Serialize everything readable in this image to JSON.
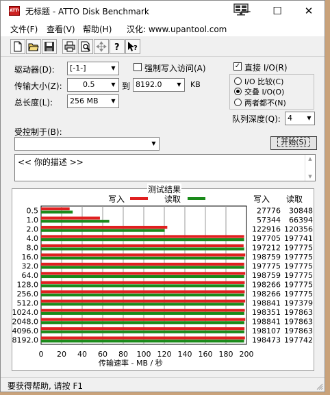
{
  "window": {
    "app_icon_text": "ATTO",
    "title": "无标题 - ATTO Disk Benchmark",
    "min_glyph": "—",
    "max_glyph": "☐",
    "close_glyph": "✕"
  },
  "menu": {
    "file": "文件(F)",
    "view": "查看(V)",
    "help": "帮助(H)",
    "localized": "汉化: www.upantool.com"
  },
  "icons": [
    "new-file-icon",
    "open-folder-icon",
    "save-icon",
    "print-icon",
    "print-preview-icon",
    "move-icon",
    "help-icon",
    "context-help-icon"
  ],
  "form": {
    "drive_label": "驱动器(D):",
    "drive_value": "[-1-]",
    "force_write_label": "强制写入访问(A)",
    "transfer_label": "传输大小(Z):",
    "transfer_from": "0.5",
    "to_label": "到",
    "transfer_to": "8192.0",
    "kb_label": "KB",
    "length_label": "总长度(L):",
    "length_value": "256 MB",
    "direct_io_label": "直接 I/O(R)",
    "io_compare_label": "I/O 比较(C)",
    "overlap_io_label": "交叠 I/O(O)",
    "neither_label": "两者都不(N)",
    "queue_label": "队列深度(Q):",
    "queue_value": "4",
    "controlled_by_label": "受控制于(B):",
    "controlled_by_value": "",
    "start_button": "开始(S)",
    "description": "<<   你的描述    >>"
  },
  "results": {
    "title": "测试结果",
    "write_legend": "写入",
    "read_legend": "读取",
    "write_col": "写入",
    "read_col": "读取",
    "xlabel": "传输速率 - MB / 秒"
  },
  "chart_data": {
    "type": "bar",
    "orientation": "horizontal",
    "title": "测试结果",
    "xlabel": "传输速率 - MB / 秒",
    "xlim": [
      0,
      200
    ],
    "xticks": [
      0,
      20,
      40,
      60,
      80,
      100,
      120,
      140,
      160,
      180,
      200
    ],
    "categories": [
      "0.5",
      "1.0",
      "2.0",
      "4.0",
      "8.0",
      "16.0",
      "32.0",
      "64.0",
      "128.0",
      "256.0",
      "512.0",
      "1024.0",
      "2048.0",
      "4096.0",
      "8192.0"
    ],
    "series": [
      {
        "name": "写入",
        "color": "#e02020",
        "values": [
          27.8,
          57.3,
          122.9,
          197.7,
          197.2,
          198.8,
          197.8,
          198.8,
          198.3,
          198.3,
          198.8,
          198.4,
          198.8,
          198.1,
          198.5
        ],
        "labels": [
          "27776",
          "57344",
          "122916",
          "197705",
          "197212",
          "198759",
          "197775",
          "198759",
          "198266",
          "198266",
          "198841",
          "198351",
          "198841",
          "198107",
          "198473"
        ]
      },
      {
        "name": "读取",
        "color": "#1a8a1a",
        "values": [
          30.8,
          66.4,
          120.4,
          197.7,
          197.8,
          197.8,
          197.8,
          197.8,
          197.8,
          197.8,
          197.4,
          197.9,
          197.9,
          197.9,
          197.7
        ],
        "labels": [
          "30848",
          "66394",
          "120356",
          "197741",
          "197775",
          "197775",
          "197775",
          "197775",
          "197775",
          "197775",
          "197379",
          "197863",
          "197863",
          "197863",
          "197742"
        ]
      }
    ]
  },
  "status": {
    "text": "要获得帮助, 请按 F1"
  }
}
